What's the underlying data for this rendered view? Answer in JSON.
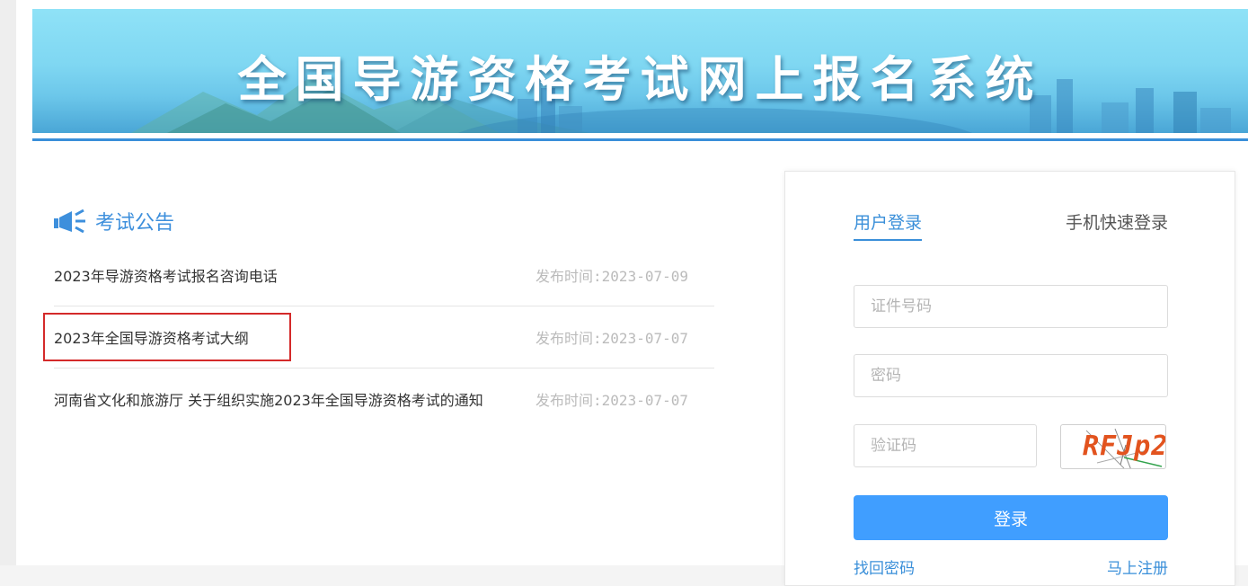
{
  "banner": {
    "title": "全国导游资格考试网上报名系统"
  },
  "announcements": {
    "heading": "考试公告",
    "items": [
      {
        "title": "2023年导游资格考试报名咨询电话",
        "date": "发布时间:2023-07-09"
      },
      {
        "title": "2023年全国导游资格考试大纲",
        "date": "发布时间:2023-07-07"
      },
      {
        "title": "河南省文化和旅游厅 关于组织实施2023年全国导游资格考试的通知",
        "date": "发布时间:2023-07-07"
      }
    ]
  },
  "login": {
    "tab_account": "用户登录",
    "tab_phone": "手机快速登录",
    "id_placeholder": "证件号码",
    "password_placeholder": "密码",
    "captcha_placeholder": "验证码",
    "captcha_text": "RFJp2",
    "submit_label": "登录",
    "forgot_label": "找回密码",
    "register_label": "马上注册"
  },
  "colors": {
    "accent": "#3a8fd9",
    "button": "#409eff",
    "highlight_border": "#d42a2a",
    "captcha_text": "#e2531e"
  }
}
